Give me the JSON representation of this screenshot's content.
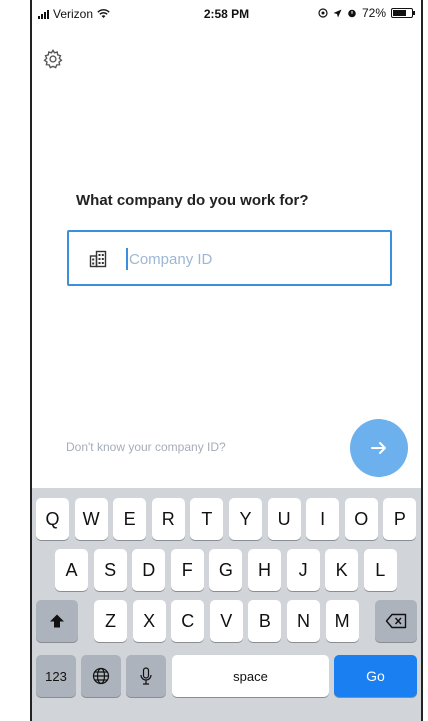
{
  "status_bar": {
    "carrier": "Verizon",
    "time": "2:58 PM",
    "battery": "72%",
    "battery_level": 0.72
  },
  "settings": {
    "icon": "gear-icon"
  },
  "prompt": {
    "question": "What company do you work for?"
  },
  "company_field": {
    "placeholder": "Company ID",
    "value": "",
    "icon": "building-icon"
  },
  "help": {
    "link_text": "Don't know your company ID?"
  },
  "next": {
    "icon": "arrow-right-icon",
    "color": "#6cb0ee"
  },
  "keyboard": {
    "row1": [
      "Q",
      "W",
      "E",
      "R",
      "T",
      "Y",
      "U",
      "I",
      "O",
      "P"
    ],
    "row2": [
      "A",
      "S",
      "D",
      "F",
      "G",
      "H",
      "J",
      "K",
      "L"
    ],
    "row3": [
      "Z",
      "X",
      "C",
      "V",
      "B",
      "N",
      "M"
    ],
    "numbers_label": "123",
    "space_label": "space",
    "go_label": "Go",
    "shift_icon": "shift-icon",
    "delete_icon": "delete-icon",
    "globe_icon": "globe-icon",
    "mic_icon": "microphone-icon",
    "accent": "#1a7ff1"
  }
}
